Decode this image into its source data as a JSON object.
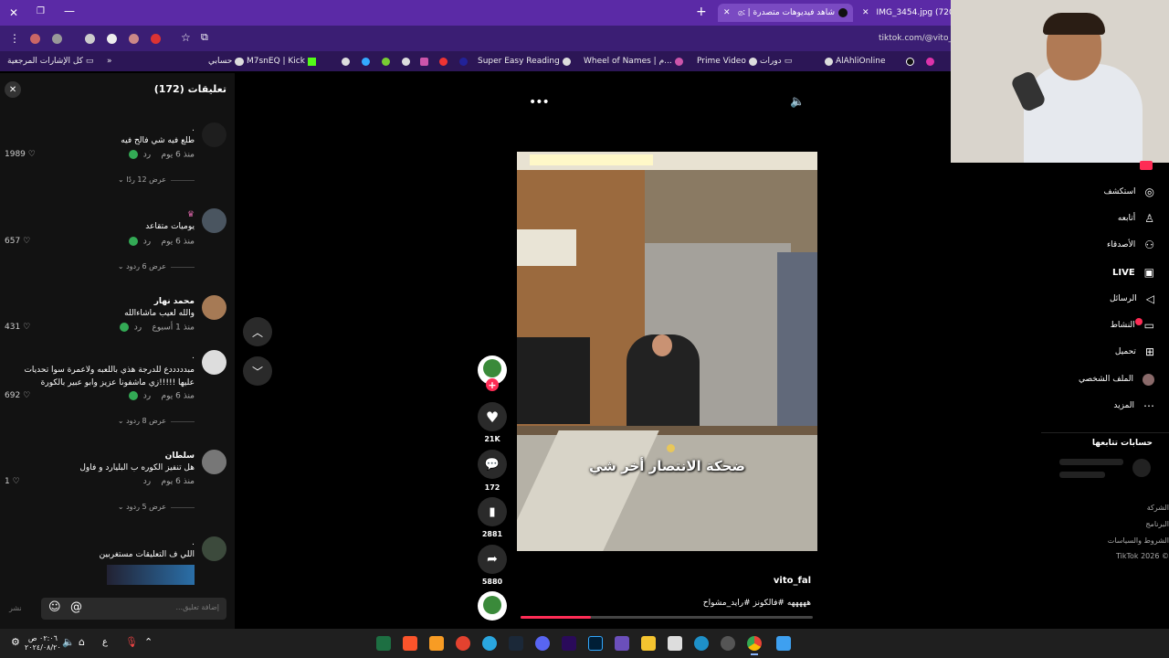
{
  "browser": {
    "tabs": [
      {
        "label": "IMG_3454.jpg (720×96",
        "active": false
      },
      {
        "label": "شاهد فيديوهات متصدرة | ok",
        "active": true
      }
    ],
    "url": "tiktok.com/@vito_",
    "bookmarks": [
      "كل الإشارات المرجعية",
      "حسابي",
      "M7snEQ | Kick",
      "Super Easy Reading",
      "Wheel of Names | م...",
      "Prime Video",
      "دورات",
      "AlAhliOnline"
    ]
  },
  "comments_panel": {
    "title": "تعليقات (172)",
    "comments": [
      {
        "name": ".",
        "text": "طلع فيه شي فالح فيه",
        "time": "منذ 6 يوم",
        "reply": "رد",
        "likes": "1989",
        "replies": "عرض 12 ردًا"
      },
      {
        "name": "",
        "text": "يوميات متقاعد",
        "time": "منذ 6 يوم",
        "reply": "رد",
        "likes": "657",
        "replies": "عرض 6 ردود"
      },
      {
        "name": "محمد نهار",
        "text": "والله لعيب ماشاءالله",
        "time": "منذ 1 أسبوع",
        "reply": "رد",
        "likes": "431",
        "replies": ""
      },
      {
        "name": ".",
        "text": "مبدددددع للدرجة هذي باللعبه ولاعمرة سوا تحديات عليها !!!!!زي ماشفونا عزيز وابو عبير بالكورة",
        "time": "منذ 6 يوم",
        "reply": "رد",
        "likes": "692",
        "replies": "عرض 8 ردود"
      },
      {
        "name": "سلطان",
        "text": "هل تنفيز الكوره ب البليارد و فاول",
        "time": "منذ 6 يوم",
        "reply": "رد",
        "likes": "1",
        "replies": "عرض 5 ردود"
      },
      {
        "name": ".",
        "text": "اللي ف التعليقات مستغربين",
        "time": "",
        "reply": "",
        "likes": "",
        "replies": ""
      }
    ],
    "input_placeholder": "إضافة تعليق...",
    "post_label": "نشر"
  },
  "video": {
    "caption": "ضحكة الانتصار أخر شي",
    "author": "vito_fal",
    "description": "هههههه #فالكونز #رايد_مشواح",
    "progress_percent": 24,
    "actions": [
      {
        "name": "like",
        "count": "21K"
      },
      {
        "name": "comment",
        "count": "172"
      },
      {
        "name": "bookmark",
        "count": "2881"
      },
      {
        "name": "share",
        "count": "5880"
      }
    ]
  },
  "right_nav": {
    "items": [
      "استكشف",
      "أتابعه",
      "الأصدقاء",
      "LIVE",
      "الرسائل",
      "النشاط",
      "تحميل",
      "الملف الشخصي",
      "المزيد"
    ],
    "following_title": "حسابات تتابعها",
    "footer": [
      "الشركة",
      "البرنامج",
      "الشروط والسياسات",
      "TikTok 2026 ©"
    ]
  },
  "taskbar": {
    "time": "٠٢:٠٦ ص",
    "date": "٢٠٢٤/٠٨/٢٠",
    "lang": "ع"
  }
}
